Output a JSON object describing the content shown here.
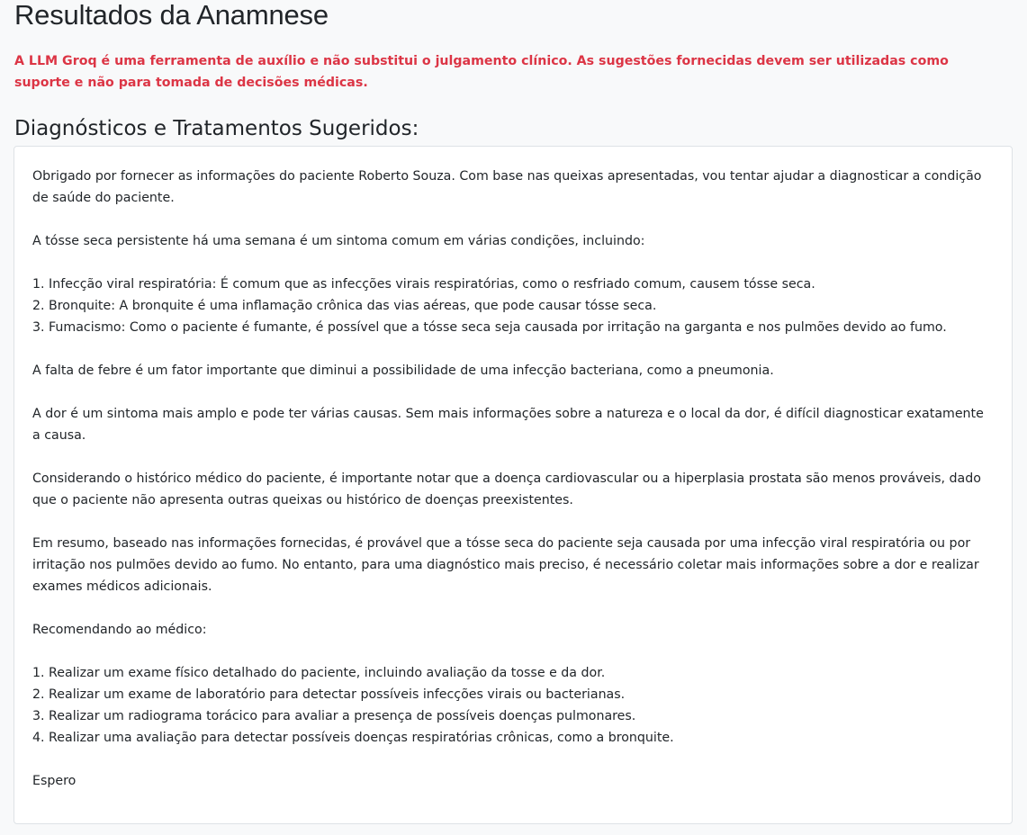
{
  "page": {
    "title": "Resultados da Anamnese",
    "disclaimer": "A LLM Groq é uma ferramenta de auxílio e não substitui o julgamento clínico. As sugestões fornecidas devem ser utilizadas como suporte e não para tomada de decisões médicas.",
    "section_title": "Diagnósticos e Tratamentos Sugeridos:"
  },
  "result": {
    "intro": "Obrigado por fornecer as informações do paciente Roberto Souza. Com base nas queixas apresentadas, vou tentar ajudar a diagnosticar a condição de saúde do paciente.",
    "symptom_intro": "A tósse seca persistente há uma semana é um sintoma comum em várias condições, incluindo:",
    "conditions": [
      "1. Infecção viral respiratória: É comum que as infecções virais respiratórias, como o resfriado comum, causem tósse seca.",
      "2. Bronquite: A bronquite é uma inflamação crônica das vias aéreas, que pode causar tósse seca.",
      "3. Fumacismo: Como o paciente é fumante, é possível que a tósse seca seja causada por irritação na garganta e nos pulmões devido ao fumo."
    ],
    "fever_note": "A falta de febre é um fator importante que diminui a possibilidade de uma infecção bacteriana, como a pneumonia.",
    "pain_note": "A dor é um sintoma mais amplo e pode ter várias causas. Sem mais informações sobre a natureza e o local da dor, é difícil diagnosticar exatamente a causa.",
    "history_note": "Considerando o histórico médico do paciente, é importante notar que a doença cardiovascular ou a hiperplasia prostata são menos prováveis, dado que o paciente não apresenta outras queixas ou histórico de doenças preexistentes.",
    "summary": "Em resumo, baseado nas informações fornecidas, é provável que a tósse seca do paciente seja causada por uma infecção viral respiratória ou por irritação nos pulmões devido ao fumo. No entanto, para uma diagnóstico mais preciso, é necessário coletar mais informações sobre a dor e realizar exames médicos adicionais.",
    "recommend_intro": "Recomendando ao médico:",
    "recommendations": [
      "1. Realizar um exame físico detalhado do paciente, incluindo avaliação da tosse e da dor.",
      "2. Realizar um exame de laboratório para detectar possíveis infecções virais ou bacterianas.",
      "3. Realizar um radiograma torácico para avaliar a presença de possíveis doenças pulmonares.",
      "4. Realizar uma avaliação para detectar possíveis doenças respiratórias crônicas, como a bronquite."
    ],
    "closing": "Espero"
  },
  "colors": {
    "disclaimer": "#dc3545",
    "text": "#212529",
    "background": "#f8f9fa",
    "card": "#ffffff",
    "border": "#dee2e6"
  }
}
